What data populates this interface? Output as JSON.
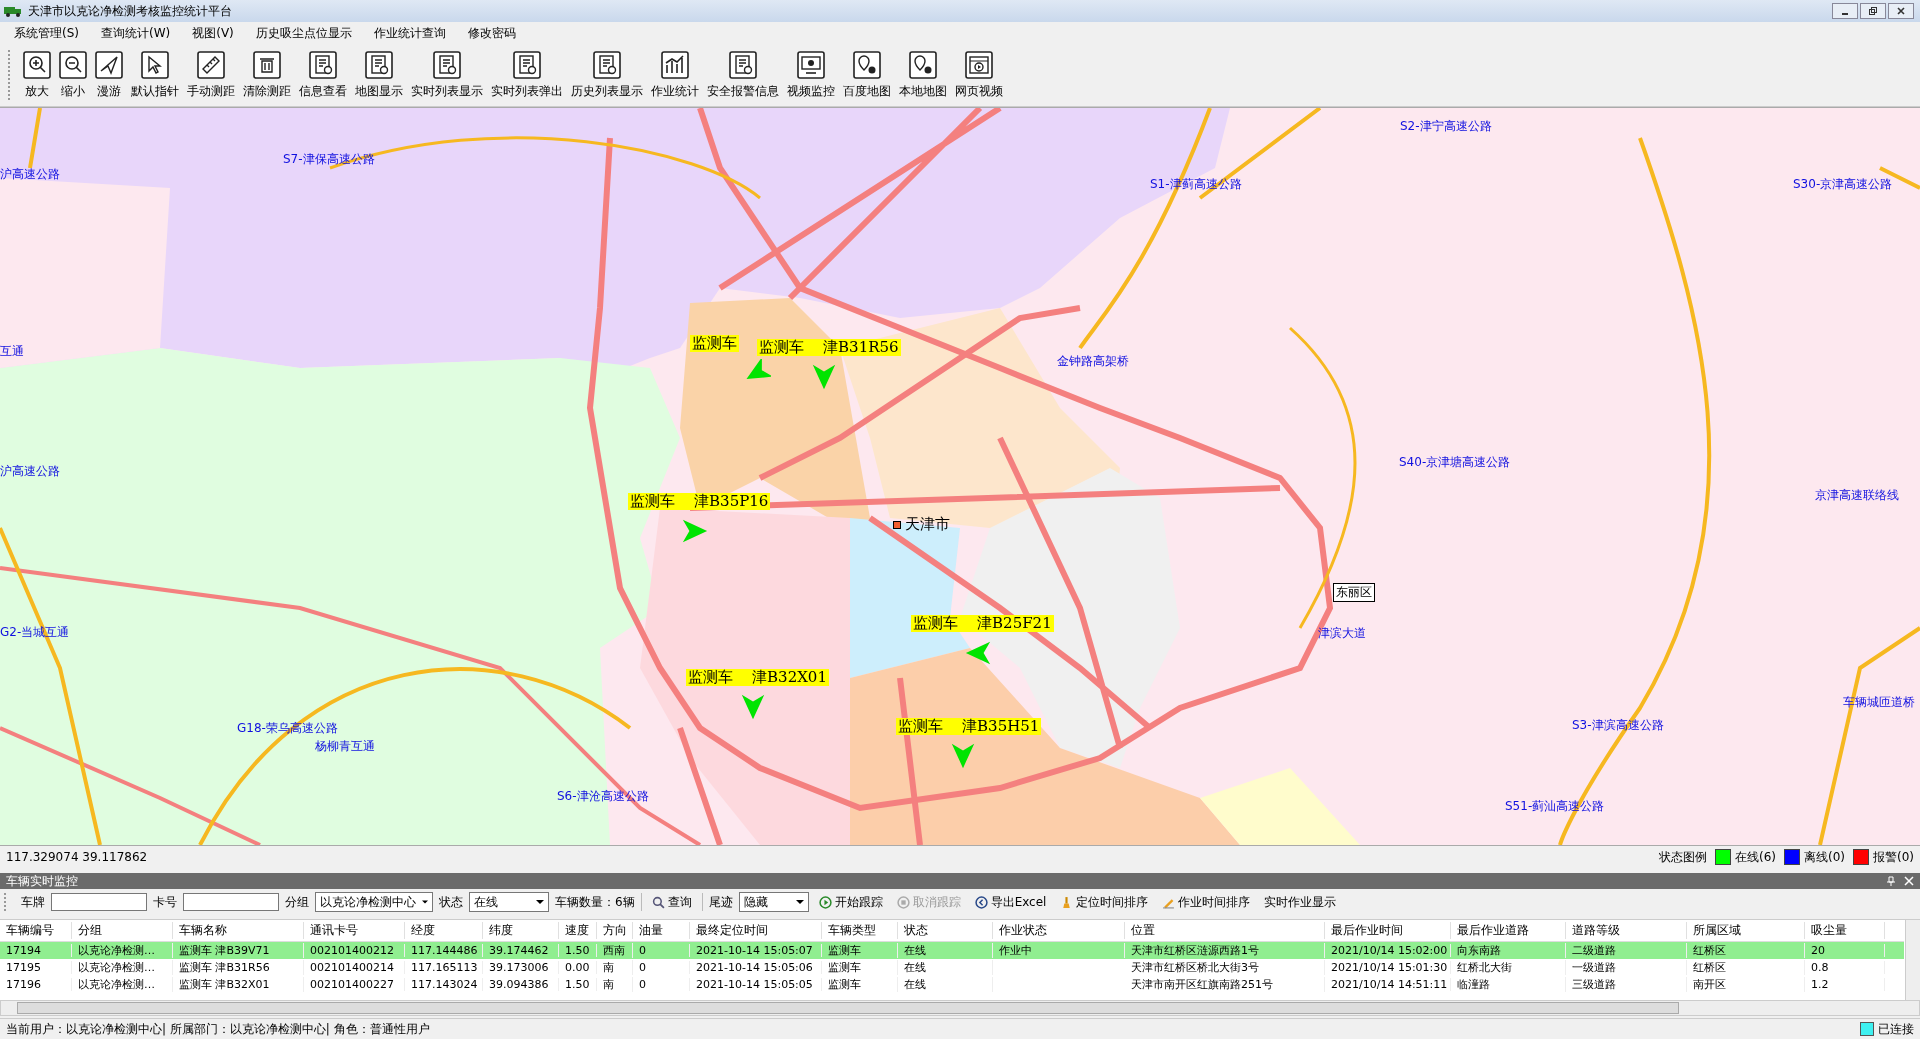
{
  "window": {
    "title": "天津市以克论净检测考核监控统计平台"
  },
  "menu": [
    "系统管理(S)",
    "查询统计(W)",
    "视图(V)",
    "历史吸尘点位显示",
    "作业统计查询",
    "修改密码"
  ],
  "toolbar": [
    "放大",
    "缩小",
    "漫游",
    "默认指针",
    "手动测距",
    "清除测距",
    "信息查看",
    "地图显示",
    "实时列表显示",
    "实时列表弹出",
    "历史列表显示",
    "作业统计",
    "安全报警信息",
    "视频监控",
    "百度地图",
    "本地地图",
    "网页视频"
  ],
  "map": {
    "labels": [
      "沪高速公路",
      "S7-津保高速公路",
      "S2-津宁高速公路",
      "S1-津蓟高速公路",
      "S30-京津高速公路",
      "互通",
      "金钟路高架桥",
      "沪高速公路",
      "S40-京津塘高速公路",
      "京津高速联络线",
      "G2-当城互通",
      "津滨大道",
      "车辆城匝道桥",
      "G18-荣乌高速公路",
      "杨柳青互通",
      "S3-津滨高速公路",
      "S51-蓟汕高速公路",
      "S6-津沧高速公路"
    ],
    "city": "天津市",
    "district": "东丽区",
    "vehicles": [
      {
        "type": "监测车"
      },
      {
        "type": "监测车",
        "plate": "津B31R56"
      },
      {
        "type": "监测车",
        "plate": "津B35P16"
      },
      {
        "type": "监测车",
        "plate": "津B25F21"
      },
      {
        "type": "监测车",
        "plate": "津B32X01"
      },
      {
        "type": "监测车",
        "plate": "津B35H51"
      }
    ]
  },
  "coordinates": "117.329074  39.117862",
  "legend": {
    "label": "状态图例",
    "items": [
      {
        "text": "在线(6)",
        "color": "#00ff00"
      },
      {
        "text": "离线(0)",
        "color": "#0000ff"
      },
      {
        "text": "报警(0)",
        "color": "#ff0000"
      }
    ]
  },
  "panel": {
    "title": "车辆实时监控",
    "filters": {
      "plate_label": "车牌",
      "card_label": "卡号",
      "group_label": "分组",
      "group_value": "以克论净检测中心",
      "status_label": "状态",
      "status_value": "在线",
      "count": "车辆数量：6辆",
      "query": "查询",
      "trail_label": "尾迹",
      "trail_value": "隐藏"
    },
    "actions": [
      {
        "text": "开始跟踪",
        "disabled": false,
        "kind": "play"
      },
      {
        "text": "取消跟踪",
        "disabled": true,
        "kind": "stop"
      },
      {
        "text": "导出Excel",
        "disabled": false,
        "kind": "export"
      },
      {
        "text": "定位时间排序",
        "disabled": false,
        "kind": "brush"
      },
      {
        "text": "作业时间排序",
        "disabled": false,
        "kind": "pencil"
      },
      {
        "text": "实时作业显示",
        "disabled": false,
        "kind": "none"
      }
    ],
    "columns": [
      "车辆编号",
      "分组",
      "车辆名称",
      "通讯卡号",
      "经度",
      "纬度",
      "速度",
      "方向",
      "油量",
      "最终定位时间",
      "车辆类型",
      "状态",
      "作业状态",
      "位置",
      "最后作业时间",
      "最后作业道路",
      "道路等级",
      "所属区域",
      "吸尘量"
    ],
    "rows": [
      {
        "selected": true,
        "cells": [
          "17194",
          "以克论净检测…",
          "监测车  津B39V71",
          "002101400212",
          "117.144486",
          "39.174462",
          "1.50",
          "西南",
          "0",
          "2021-10-14 15:05:07",
          "监测车",
          "在线",
          "作业中",
          "天津市红桥区涟源西路1号",
          "2021/10/14 15:02:00",
          "向东南路",
          "二级道路",
          "红桥区",
          "20"
        ]
      },
      {
        "selected": false,
        "cells": [
          "17195",
          "以克论净检测…",
          "监测车  津B31R56",
          "002101400214",
          "117.165113",
          "39.173006",
          "0.00",
          "南",
          "0",
          "2021-10-14 15:05:06",
          "监测车",
          "在线",
          "",
          "天津市红桥区桥北大街3号",
          "2021/10/14 15:01:30",
          "红桥北大街",
          "一级道路",
          "红桥区",
          "0.8"
        ]
      },
      {
        "selected": false,
        "cells": [
          "17196",
          "以克论净检测…",
          "监测车  津B32X01",
          "002101400227",
          "117.143024",
          "39.094386",
          "1.50",
          "南",
          "0",
          "2021-10-14 15:05:05",
          "监测车",
          "在线",
          "",
          "天津市南开区红旗南路251号",
          "2021/10/14 14:51:11",
          "临潼路",
          "三级道路",
          "南开区",
          "1.2"
        ]
      }
    ]
  },
  "status_bar": {
    "user": "当前用户：以克论净检测中心| 所属部门：以克论净检测中心| 角色：普通性用户",
    "connection": "已连接"
  }
}
